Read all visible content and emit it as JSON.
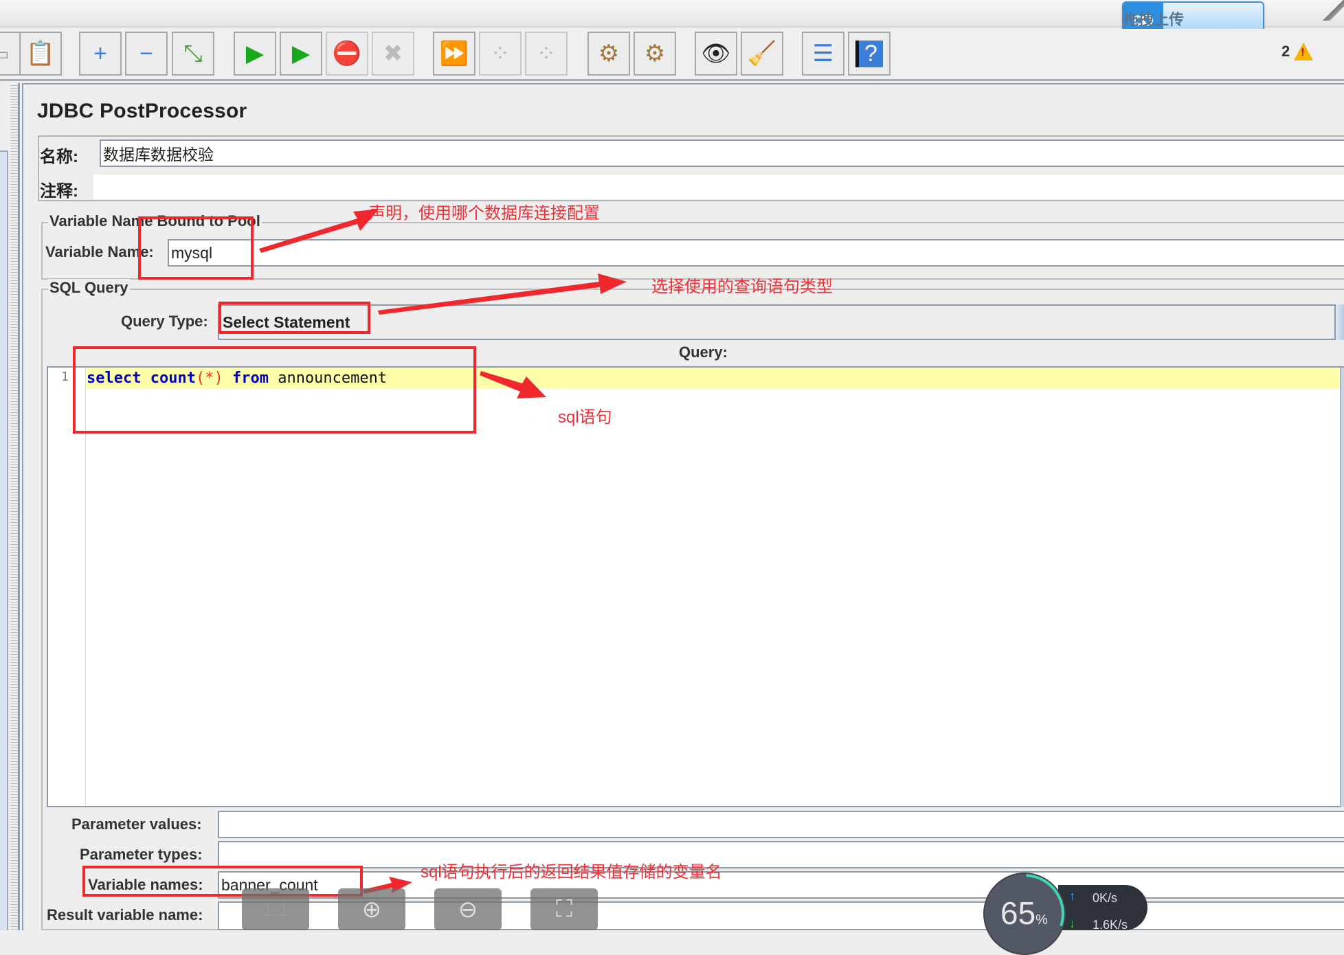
{
  "upload_widget": {
    "icon": "cloud-link-icon",
    "label": "拖拽上传"
  },
  "toolbar": {
    "buttons": [
      {
        "name": "paste-button",
        "icon": "clipboard-icon",
        "glyph": "📋",
        "enabled": true
      },
      {
        "name": "expand-button",
        "icon": "plus-icon",
        "glyph": "+",
        "enabled": true
      },
      {
        "name": "collapse-button",
        "icon": "minus-icon",
        "glyph": "−",
        "enabled": true
      },
      {
        "name": "toggle-button",
        "icon": "toggle-icon",
        "glyph": "⤡",
        "enabled": true
      },
      {
        "name": "start-button",
        "icon": "play-icon",
        "glyph": "▶",
        "enabled": true
      },
      {
        "name": "start-no-pause-button",
        "icon": "play-no-timer-icon",
        "glyph": "▶",
        "enabled": true
      },
      {
        "name": "stop-button",
        "icon": "stop-icon",
        "glyph": "⛔",
        "enabled": false
      },
      {
        "name": "shutdown-button",
        "icon": "shutdown-icon",
        "glyph": "✖",
        "enabled": false
      },
      {
        "name": "remote-start-all-button",
        "icon": "remote-start-icon",
        "glyph": "⏩",
        "enabled": true
      },
      {
        "name": "remote-stop-all-button",
        "icon": "remote-stop-icon",
        "glyph": "⁘",
        "enabled": false
      },
      {
        "name": "remote-shutdown-all-button",
        "icon": "remote-shutdown-icon",
        "glyph": "⁘",
        "enabled": false
      },
      {
        "name": "clear-button",
        "icon": "gear-broom-icon",
        "glyph": "⚙",
        "enabled": true
      },
      {
        "name": "clear-all-button",
        "icon": "gear-brooms-icon",
        "glyph": "⚙",
        "enabled": true
      },
      {
        "name": "search-button",
        "icon": "binoculars-icon",
        "glyph": "👁",
        "enabled": true
      },
      {
        "name": "reset-search-button",
        "icon": "broom-icon",
        "glyph": "🧹",
        "enabled": true
      },
      {
        "name": "function-helper-button",
        "icon": "list-icon",
        "glyph": "☰",
        "enabled": true
      },
      {
        "name": "help-button",
        "icon": "help-book-icon",
        "glyph": "?",
        "enabled": true
      }
    ],
    "warning_count": "2"
  },
  "panel": {
    "title": "JDBC PostProcessor",
    "name_label": "名称:",
    "name_value": "数据库数据校验",
    "comment_label": "注释:",
    "comment_value": "",
    "pool_group": {
      "legend": "Variable Name Bound to Pool",
      "variable_name_label": "Variable Name:",
      "variable_name_value": "mysql"
    },
    "sql_group": {
      "legend": "SQL Query",
      "query_type_label": "Query Type:",
      "query_type_value": "Select Statement",
      "query_label": "Query:",
      "line_number": "1",
      "query_tokens": [
        {
          "text": "select",
          "kind": "kw"
        },
        {
          "text": " ",
          "kind": "tx"
        },
        {
          "text": "count",
          "kind": "kw"
        },
        {
          "text": "(*)",
          "kind": "pn"
        },
        {
          "text": " ",
          "kind": "tx"
        },
        {
          "text": "from",
          "kind": "kw"
        },
        {
          "text": " announcement",
          "kind": "tx"
        }
      ]
    },
    "parameter_values_label": "Parameter values:",
    "parameter_values_value": "",
    "parameter_types_label": "Parameter types:",
    "parameter_types_value": "",
    "variable_names_label": "Variable names:",
    "variable_names_value": "banner_count",
    "result_variable_label": "Result variable name:",
    "result_variable_value": ""
  },
  "annotations": {
    "pool_note": "声明，使用哪个数据库连接配置",
    "query_type_note": "选择使用的查询语句类型",
    "sql_note": "sql语句",
    "variable_names_note": "sql语句执行后的返回结果值存储的变量名",
    "color": "#f0282e"
  },
  "viewer_controls": [
    {
      "name": "actual-size-button",
      "icon": "one-to-one-icon",
      "label": "1:1"
    },
    {
      "name": "zoom-in-button",
      "icon": "zoom-in-icon",
      "label": "⊕"
    },
    {
      "name": "zoom-out-button",
      "icon": "zoom-out-icon",
      "label": "⊖"
    },
    {
      "name": "fit-screen-button",
      "icon": "fit-screen-icon",
      "label": "⛶"
    }
  ],
  "net_monitor": {
    "percent": 65,
    "percent_unit": "%",
    "upload_speed": "0K/s",
    "download_speed": "1.6K/s"
  }
}
